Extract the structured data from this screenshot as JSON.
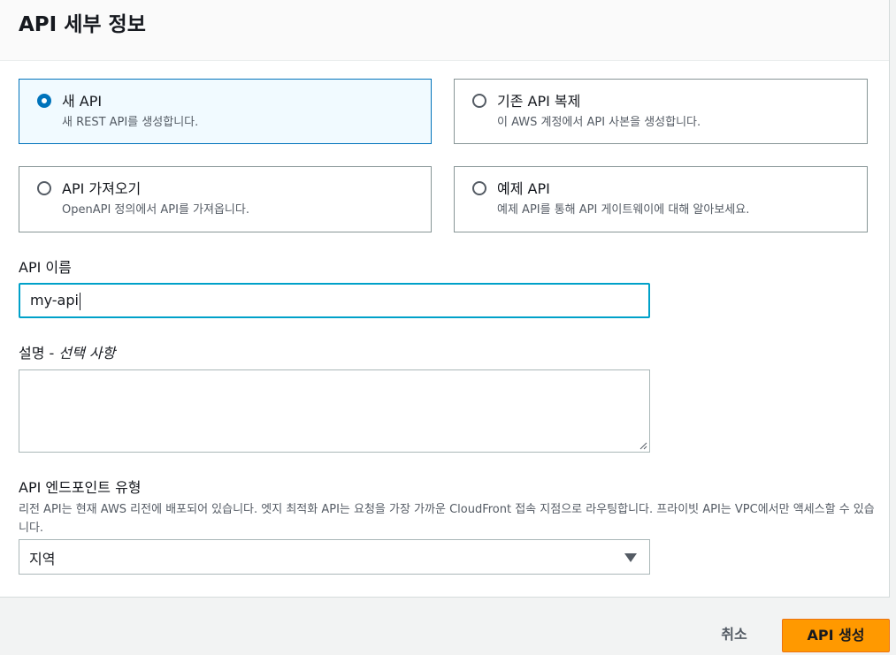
{
  "panel": {
    "title": "API 세부 정보"
  },
  "options": [
    {
      "title": "새 API",
      "desc": "새 REST API를 생성합니다.",
      "selected": true
    },
    {
      "title": "기존 API 복제",
      "desc": "이 AWS 계정에서 API 사본을 생성합니다.",
      "selected": false
    },
    {
      "title": "API 가져오기",
      "desc": "OpenAPI 정의에서 API를 가져옵니다.",
      "selected": false
    },
    {
      "title": "예제 API",
      "desc": "예제 API를 통해 API 게이트웨이에 대해 알아보세요.",
      "selected": false
    }
  ],
  "api_name": {
    "label": "API 이름",
    "value": "my-api"
  },
  "description": {
    "label": "설명 - ",
    "optional": "선택 사항",
    "value": ""
  },
  "endpoint": {
    "label": "API 엔드포인트 유형",
    "help": "리전 API는 현재 AWS 리전에 배포되어 있습니다. 엣지 최적화 API는 요청을 가장 가까운 CloudFront 접속 지점으로 라우팅합니다. 프라이빗 API는 VPC에서만 액세스할 수 있습니다.",
    "selected": "지역"
  },
  "footer": {
    "cancel": "취소",
    "create": "API 생성"
  },
  "colors": {
    "accent": "#0073bb",
    "primary_button": "#ff9900",
    "focus": "#00a1c9"
  }
}
